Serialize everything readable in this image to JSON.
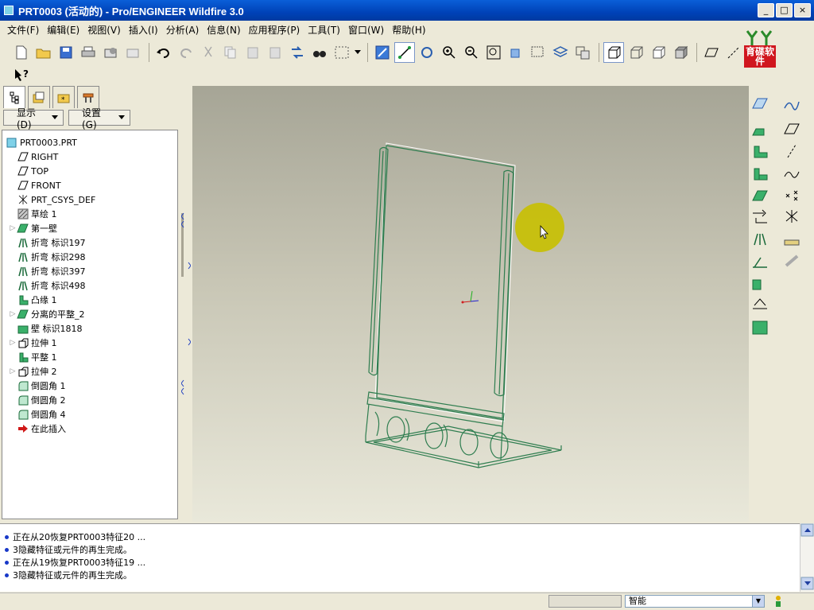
{
  "window": {
    "title": "PRT0003 (活动的) - Pro/ENGINEER Wildfire 3.0",
    "minimize_label": "_",
    "maximize_label": "□",
    "close_label": "×"
  },
  "menubar": {
    "items": [
      {
        "label": "文件(F)"
      },
      {
        "label": "编辑(E)"
      },
      {
        "label": "视图(V)"
      },
      {
        "label": "插入(I)"
      },
      {
        "label": "分析(A)"
      },
      {
        "label": "信息(N)"
      },
      {
        "label": "应用程序(P)"
      },
      {
        "label": "工具(T)"
      },
      {
        "label": "窗口(W)"
      },
      {
        "label": "帮助(H)"
      }
    ]
  },
  "logo": {
    "text": "育碟软件",
    "colors": {
      "red": "#d0161e",
      "green": "#2a8a2a"
    }
  },
  "model_tree": {
    "show_label": "显示(D)",
    "settings_label": "设置(G)",
    "items": [
      {
        "label": "PRT0003.PRT",
        "icon": "part-icon",
        "expandable": false
      },
      {
        "label": "RIGHT",
        "icon": "datum-plane-icon",
        "expandable": false
      },
      {
        "label": "TOP",
        "icon": "datum-plane-icon",
        "expandable": false
      },
      {
        "label": "FRONT",
        "icon": "datum-plane-icon",
        "expandable": false
      },
      {
        "label": "PRT_CSYS_DEF",
        "icon": "csys-icon",
        "expandable": false
      },
      {
        "label": "草绘 1",
        "icon": "sketch-icon",
        "expandable": false
      },
      {
        "label": "第一壁",
        "icon": "sheetmetal-wall-icon",
        "expandable": true
      },
      {
        "label": "折弯 标识197",
        "icon": "bend-icon",
        "expandable": false
      },
      {
        "label": "折弯 标识298",
        "icon": "bend-icon",
        "expandable": false
      },
      {
        "label": "折弯 标识397",
        "icon": "bend-icon",
        "expandable": false
      },
      {
        "label": "折弯 标识498",
        "icon": "bend-icon",
        "expandable": false
      },
      {
        "label": "凸缘 1",
        "icon": "flange-icon",
        "expandable": false
      },
      {
        "label": "分离的平整_2",
        "icon": "sheetmetal-wall-icon",
        "expandable": true
      },
      {
        "label": "壁 标识1818",
        "icon": "wall-icon",
        "expandable": false
      },
      {
        "label": "拉伸 1",
        "icon": "extrude-icon",
        "expandable": true
      },
      {
        "label": "平整 1",
        "icon": "flat-icon",
        "expandable": false
      },
      {
        "label": "拉伸 2",
        "icon": "extrude-icon",
        "expandable": true
      },
      {
        "label": "倒圆角 1",
        "icon": "round-icon",
        "expandable": false
      },
      {
        "label": "倒圆角 2",
        "icon": "round-icon",
        "expandable": false
      },
      {
        "label": "倒圆角 4",
        "icon": "round-icon",
        "expandable": false
      },
      {
        "label": "在此插入",
        "icon": "insert-here-arrow-icon",
        "expandable": false
      }
    ]
  },
  "messages": [
    "正在从20恢复PRT0003特征20 ...",
    "3隐藏特征或元件的再生完成。",
    "正在从19恢复PRT0003特征19 ...",
    "3隐藏特征或元件的再生完成。"
  ],
  "status": {
    "filter_value": "智能"
  },
  "colors": {
    "titlebar": "#0a5fd8",
    "model_edges": "#2e7d4f",
    "cursor_highlight": "#c8c000"
  }
}
